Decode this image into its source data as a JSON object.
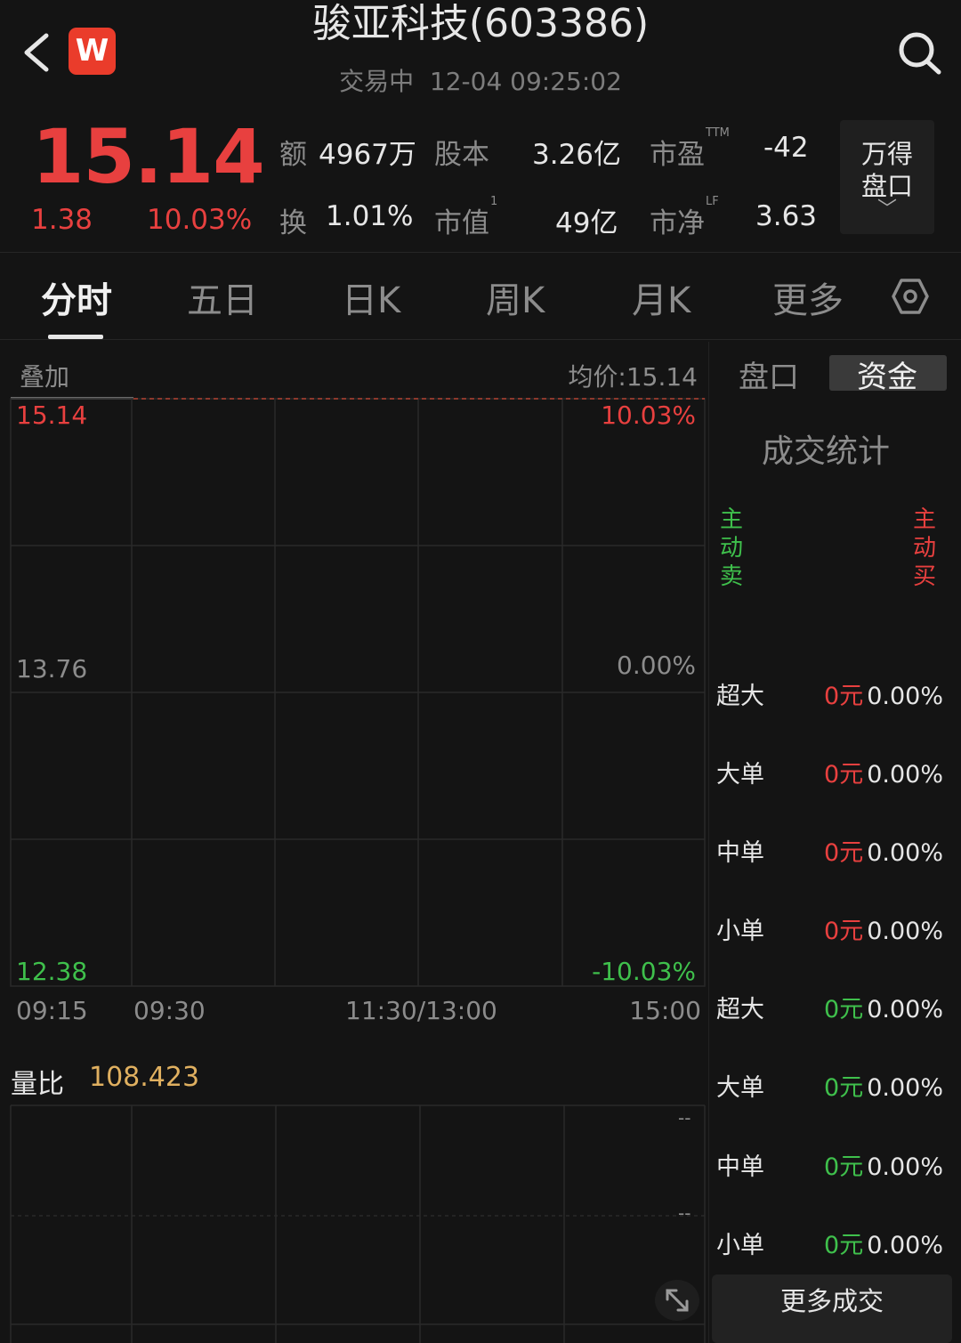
{
  "header": {
    "title": "骏亚科技(603386)",
    "status": "交易中",
    "datetime": "12-04 09:25:02",
    "logo_letter": "W",
    "icons": {
      "back": "chevron-left-icon",
      "search": "search-icon"
    }
  },
  "quote": {
    "price": "15.14",
    "change": "1.38",
    "change_pct": "10.03%",
    "colors": {
      "up": "#e8403f",
      "down": "#3fc04c"
    },
    "stats": [
      {
        "label": "额",
        "value": "4967万",
        "sup": ""
      },
      {
        "label": "股本",
        "value": "3.26亿",
        "sup": ""
      },
      {
        "label": "市盈",
        "value": "-42",
        "sup": "TTM"
      },
      {
        "label": "换",
        "value": "1.01%",
        "sup": ""
      },
      {
        "label": "市值",
        "value": "49亿",
        "sup": "1"
      },
      {
        "label": "市净",
        "value": "3.63",
        "sup": "LF"
      }
    ],
    "wind_button": {
      "line1": "万得",
      "line2": "盘口",
      "chevron": "﹀"
    }
  },
  "tabs": [
    {
      "label": "分时",
      "active": true
    },
    {
      "label": "五日",
      "active": false
    },
    {
      "label": "日K",
      "active": false
    },
    {
      "label": "周K",
      "active": false
    },
    {
      "label": "月K",
      "active": false
    },
    {
      "label": "更多",
      "active": false
    }
  ],
  "chart": {
    "overlay_label": "叠加",
    "avg_price_label": "均价:15.14",
    "price_ticks": {
      "top": "15.14",
      "mid": "13.76",
      "bottom": "12.38"
    },
    "pct_ticks": {
      "top": "10.03%",
      "mid": "0.00%",
      "bottom": "-10.03%"
    },
    "time_ticks": [
      "09:15",
      "09:30",
      "11:30/13:00",
      "15:00"
    ],
    "volume_ratio_label": "量比",
    "volume_ratio_value": "108.423",
    "volume_ticks": [
      "--",
      "--"
    ],
    "expand_icon": "expand-arrows-icon"
  },
  "right_panel": {
    "tabs": [
      {
        "label": "盘口",
        "active": false
      },
      {
        "label": "资金",
        "active": true
      }
    ],
    "title": "成交统计",
    "sell_header": [
      "主",
      "动",
      "卖"
    ],
    "buy_header": [
      "主",
      "动",
      "买"
    ],
    "buy_rows": [
      {
        "label": "超大",
        "amount": "0元",
        "pct": "0.00%"
      },
      {
        "label": "大单",
        "amount": "0元",
        "pct": "0.00%"
      },
      {
        "label": "中单",
        "amount": "0元",
        "pct": "0.00%"
      },
      {
        "label": "小单",
        "amount": "0元",
        "pct": "0.00%"
      }
    ],
    "sell_rows": [
      {
        "label": "超大",
        "amount": "0元",
        "pct": "0.00%"
      },
      {
        "label": "大单",
        "amount": "0元",
        "pct": "0.00%"
      },
      {
        "label": "中单",
        "amount": "0元",
        "pct": "0.00%"
      },
      {
        "label": "小单",
        "amount": "0元",
        "pct": "0.00%"
      }
    ],
    "more_button": "更多成交"
  }
}
